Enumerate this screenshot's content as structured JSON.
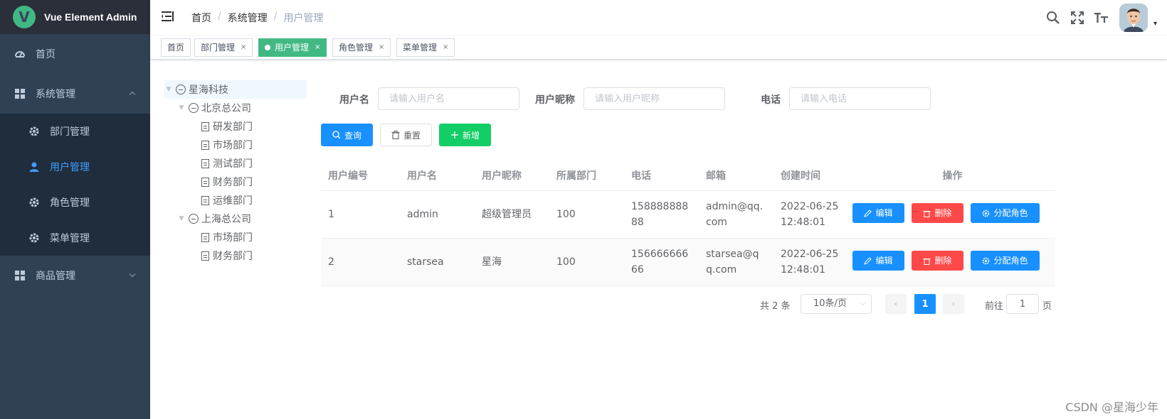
{
  "app": {
    "title": "Vue Element Admin",
    "logo_letter": "V"
  },
  "sidebar": {
    "items": [
      {
        "label": "首页",
        "icon": "dashboard-icon"
      },
      {
        "label": "系统管理",
        "icon": "grid-icon",
        "expanded": true,
        "children": [
          {
            "label": "部门管理",
            "icon": "gear-icon"
          },
          {
            "label": "用户管理",
            "icon": "user-icon",
            "active": true
          },
          {
            "label": "角色管理",
            "icon": "gear-icon"
          },
          {
            "label": "菜单管理",
            "icon": "gear-icon"
          }
        ]
      },
      {
        "label": "商品管理",
        "icon": "grid-icon",
        "expanded": false
      }
    ]
  },
  "breadcrumb": [
    "首页",
    "系统管理",
    "用户管理"
  ],
  "tags": [
    {
      "label": "首页",
      "closable": false
    },
    {
      "label": "部门管理",
      "closable": true
    },
    {
      "label": "用户管理",
      "closable": true,
      "active": true
    },
    {
      "label": "角色管理",
      "closable": true
    },
    {
      "label": "菜单管理",
      "closable": true
    }
  ],
  "tags_close_glyph": "×",
  "tree": [
    {
      "label": "星海科技",
      "level": 0,
      "expanded": true,
      "current": true
    },
    {
      "label": "北京总公司",
      "level": 1,
      "expanded": true
    },
    {
      "label": "研发部门",
      "level": 2
    },
    {
      "label": "市场部门",
      "level": 2
    },
    {
      "label": "测试部门",
      "level": 2
    },
    {
      "label": "财务部门",
      "level": 2
    },
    {
      "label": "运维部门",
      "level": 2
    },
    {
      "label": "上海总公司",
      "level": 1,
      "expanded": true
    },
    {
      "label": "市场部门",
      "level": 2
    },
    {
      "label": "财务部门",
      "level": 2
    }
  ],
  "search": {
    "username_label": "用户名",
    "username_placeholder": "请输入用户名",
    "nickname_label": "用户昵称",
    "nickname_placeholder": "请输入用户昵称",
    "phone_label": "电话",
    "phone_placeholder": "请输入电话"
  },
  "buttons": {
    "query": "查询",
    "reset": "重置",
    "add": "新增"
  },
  "table": {
    "columns": [
      "用户编号",
      "用户名",
      "用户昵称",
      "所属部门",
      "电话",
      "邮箱",
      "创建时间",
      "操作"
    ],
    "rows": [
      {
        "id": "1",
        "username": "admin",
        "nickname": "超级管理员",
        "dept": "100",
        "phone": "15888888888",
        "email": "admin@qq.com",
        "created": "2022-06-25 12:48:01"
      },
      {
        "id": "2",
        "username": "starsea",
        "nickname": "星海",
        "dept": "100",
        "phone": "15666666666",
        "email": "starsea@qq.com",
        "created": "2022-06-25 12:48:01"
      }
    ],
    "row_actions": {
      "edit": "编辑",
      "delete": "删除",
      "assign": "分配角色"
    }
  },
  "pagination": {
    "total_text": "共 2 条",
    "page_size": "10条/页",
    "current_page": "1",
    "goto_label": "前往",
    "goto_value": "1",
    "goto_unit": "页"
  },
  "watermark": "CSDN @星海少年",
  "colors": {
    "sidebar_bg": "#304156",
    "primary": "#1890ff",
    "success": "#13ce66",
    "danger": "#ff4949",
    "tag_active": "#42b983"
  }
}
